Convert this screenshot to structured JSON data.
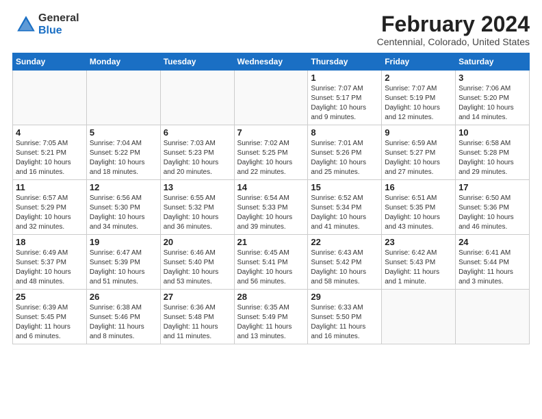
{
  "logo": {
    "general": "General",
    "blue": "Blue"
  },
  "header": {
    "title": "February 2024",
    "subtitle": "Centennial, Colorado, United States"
  },
  "days_of_week": [
    "Sunday",
    "Monday",
    "Tuesday",
    "Wednesday",
    "Thursday",
    "Friday",
    "Saturday"
  ],
  "weeks": [
    [
      {
        "day": "",
        "info": ""
      },
      {
        "day": "",
        "info": ""
      },
      {
        "day": "",
        "info": ""
      },
      {
        "day": "",
        "info": ""
      },
      {
        "day": "1",
        "info": "Sunrise: 7:07 AM\nSunset: 5:17 PM\nDaylight: 10 hours\nand 9 minutes."
      },
      {
        "day": "2",
        "info": "Sunrise: 7:07 AM\nSunset: 5:19 PM\nDaylight: 10 hours\nand 12 minutes."
      },
      {
        "day": "3",
        "info": "Sunrise: 7:06 AM\nSunset: 5:20 PM\nDaylight: 10 hours\nand 14 minutes."
      }
    ],
    [
      {
        "day": "4",
        "info": "Sunrise: 7:05 AM\nSunset: 5:21 PM\nDaylight: 10 hours\nand 16 minutes."
      },
      {
        "day": "5",
        "info": "Sunrise: 7:04 AM\nSunset: 5:22 PM\nDaylight: 10 hours\nand 18 minutes."
      },
      {
        "day": "6",
        "info": "Sunrise: 7:03 AM\nSunset: 5:23 PM\nDaylight: 10 hours\nand 20 minutes."
      },
      {
        "day": "7",
        "info": "Sunrise: 7:02 AM\nSunset: 5:25 PM\nDaylight: 10 hours\nand 22 minutes."
      },
      {
        "day": "8",
        "info": "Sunrise: 7:01 AM\nSunset: 5:26 PM\nDaylight: 10 hours\nand 25 minutes."
      },
      {
        "day": "9",
        "info": "Sunrise: 6:59 AM\nSunset: 5:27 PM\nDaylight: 10 hours\nand 27 minutes."
      },
      {
        "day": "10",
        "info": "Sunrise: 6:58 AM\nSunset: 5:28 PM\nDaylight: 10 hours\nand 29 minutes."
      }
    ],
    [
      {
        "day": "11",
        "info": "Sunrise: 6:57 AM\nSunset: 5:29 PM\nDaylight: 10 hours\nand 32 minutes."
      },
      {
        "day": "12",
        "info": "Sunrise: 6:56 AM\nSunset: 5:30 PM\nDaylight: 10 hours\nand 34 minutes."
      },
      {
        "day": "13",
        "info": "Sunrise: 6:55 AM\nSunset: 5:32 PM\nDaylight: 10 hours\nand 36 minutes."
      },
      {
        "day": "14",
        "info": "Sunrise: 6:54 AM\nSunset: 5:33 PM\nDaylight: 10 hours\nand 39 minutes."
      },
      {
        "day": "15",
        "info": "Sunrise: 6:52 AM\nSunset: 5:34 PM\nDaylight: 10 hours\nand 41 minutes."
      },
      {
        "day": "16",
        "info": "Sunrise: 6:51 AM\nSunset: 5:35 PM\nDaylight: 10 hours\nand 43 minutes."
      },
      {
        "day": "17",
        "info": "Sunrise: 6:50 AM\nSunset: 5:36 PM\nDaylight: 10 hours\nand 46 minutes."
      }
    ],
    [
      {
        "day": "18",
        "info": "Sunrise: 6:49 AM\nSunset: 5:37 PM\nDaylight: 10 hours\nand 48 minutes."
      },
      {
        "day": "19",
        "info": "Sunrise: 6:47 AM\nSunset: 5:39 PM\nDaylight: 10 hours\nand 51 minutes."
      },
      {
        "day": "20",
        "info": "Sunrise: 6:46 AM\nSunset: 5:40 PM\nDaylight: 10 hours\nand 53 minutes."
      },
      {
        "day": "21",
        "info": "Sunrise: 6:45 AM\nSunset: 5:41 PM\nDaylight: 10 hours\nand 56 minutes."
      },
      {
        "day": "22",
        "info": "Sunrise: 6:43 AM\nSunset: 5:42 PM\nDaylight: 10 hours\nand 58 minutes."
      },
      {
        "day": "23",
        "info": "Sunrise: 6:42 AM\nSunset: 5:43 PM\nDaylight: 11 hours\nand 1 minute."
      },
      {
        "day": "24",
        "info": "Sunrise: 6:41 AM\nSunset: 5:44 PM\nDaylight: 11 hours\nand 3 minutes."
      }
    ],
    [
      {
        "day": "25",
        "info": "Sunrise: 6:39 AM\nSunset: 5:45 PM\nDaylight: 11 hours\nand 6 minutes."
      },
      {
        "day": "26",
        "info": "Sunrise: 6:38 AM\nSunset: 5:46 PM\nDaylight: 11 hours\nand 8 minutes."
      },
      {
        "day": "27",
        "info": "Sunrise: 6:36 AM\nSunset: 5:48 PM\nDaylight: 11 hours\nand 11 minutes."
      },
      {
        "day": "28",
        "info": "Sunrise: 6:35 AM\nSunset: 5:49 PM\nDaylight: 11 hours\nand 13 minutes."
      },
      {
        "day": "29",
        "info": "Sunrise: 6:33 AM\nSunset: 5:50 PM\nDaylight: 11 hours\nand 16 minutes."
      },
      {
        "day": "",
        "info": ""
      },
      {
        "day": "",
        "info": ""
      }
    ]
  ]
}
